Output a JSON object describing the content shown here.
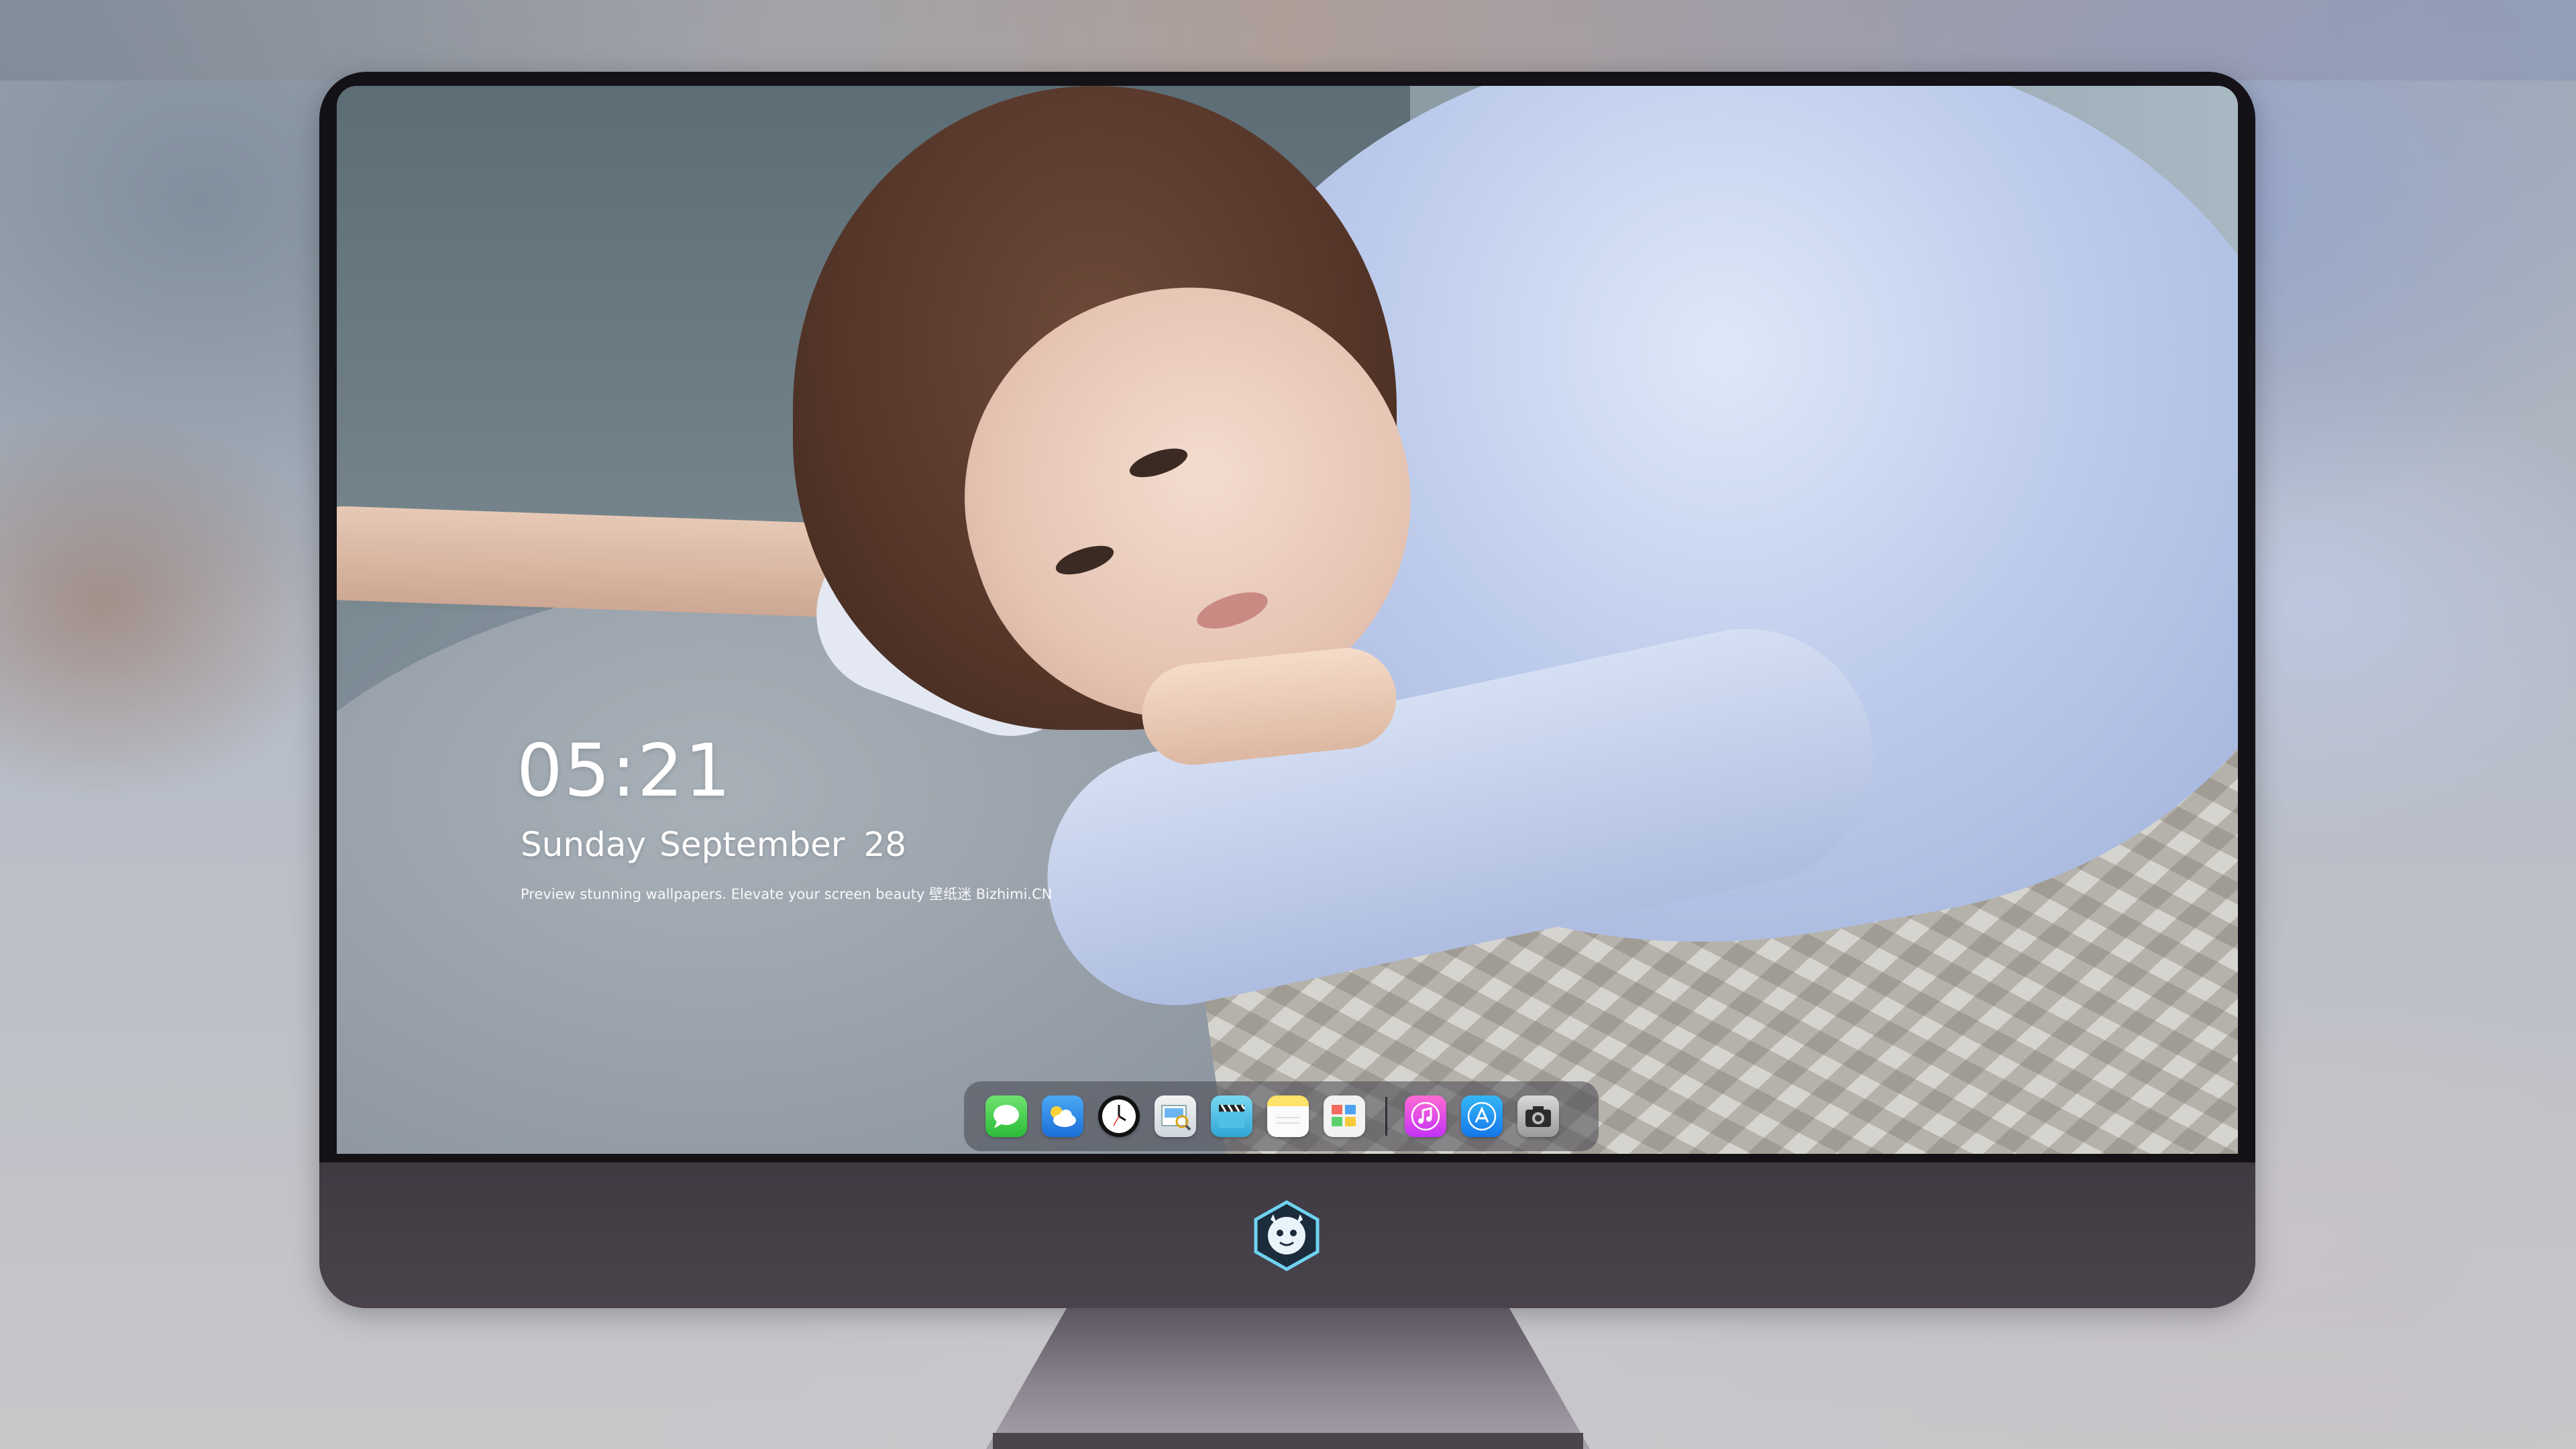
{
  "lockscreen": {
    "time": "05:21",
    "weekday": "Sunday",
    "month": "September",
    "day": "28",
    "tagline": "Preview stunning wallpapers. Elevate your screen beauty  壁纸迷  Bizhimi.CN"
  },
  "dock": {
    "apps": [
      {
        "name": "messages",
        "icon": "messages-icon"
      },
      {
        "name": "weather",
        "icon": "weather-icon"
      },
      {
        "name": "clock",
        "icon": "clock-icon"
      },
      {
        "name": "preview",
        "icon": "preview-icon"
      },
      {
        "name": "clips",
        "icon": "clapperboard-icon"
      },
      {
        "name": "notes",
        "icon": "notes-icon"
      },
      {
        "name": "photos",
        "icon": "photos-icon"
      }
    ],
    "pinned": [
      {
        "name": "music",
        "icon": "music-icon"
      },
      {
        "name": "app-store",
        "icon": "app-store-icon"
      },
      {
        "name": "camera",
        "icon": "camera-icon"
      }
    ]
  },
  "monitor": {
    "logo": "mascot-logo"
  },
  "colors": {
    "bezel": "#141216",
    "chin": "#433d46",
    "shirt": "#bccbeb",
    "dock_bg": "#46464e"
  }
}
